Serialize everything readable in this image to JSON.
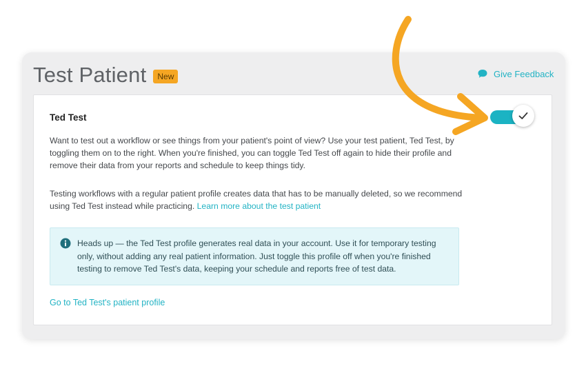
{
  "page": {
    "title": "Test Patient",
    "badge": "New",
    "feedback_label": "Give Feedback"
  },
  "card": {
    "heading": "Ted Test",
    "toggle_state": "on",
    "paragraph1": "Want to test out a workflow or see things from your patient's point of view? Use your test patient, Ted Test, by toggling them on to the right. When you're finished, you can toggle Ted Test off again to hide their profile and remove their data from your reports and schedule to keep things tidy.",
    "paragraph2": "Testing workflows with a regular patient profile creates data that has to be manually deleted, so we recommend using Ted Test instead while practicing.",
    "learn_more_link": "Learn more about the test patient",
    "notice": "Heads up — the Ted Test profile generates real data in your account. Use it for temporary testing only, without adding any real patient information. Just toggle this profile off when you're finished testing to remove Ted Test's data, keeping your schedule and reports free of test data.",
    "profile_link": "Go to Ted Test's patient profile"
  },
  "colors": {
    "accent": "#1bb3c3",
    "badge": "#f5a623",
    "arrow": "#f5a623",
    "notice_bg": "#e3f6f9"
  },
  "icons": {
    "feedback": "speech-bubble-icon",
    "notice": "info-icon",
    "toggle": "checkmark-icon",
    "annotation": "curved-arrow-icon"
  }
}
